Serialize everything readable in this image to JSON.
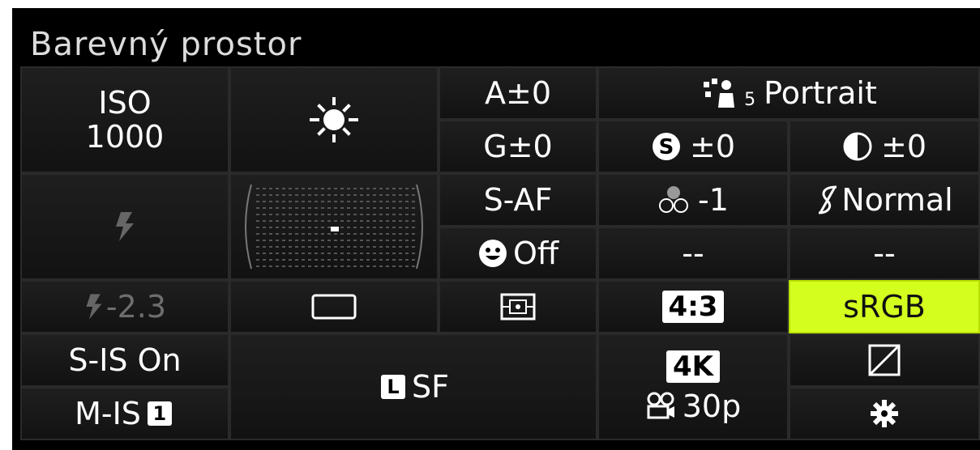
{
  "title": "Barevný prostor",
  "iso": {
    "label": "ISO",
    "value": "1000"
  },
  "white_balance": {
    "icon": "sun-icon"
  },
  "wb_adjust": {
    "a": "A±0",
    "g": "G±0"
  },
  "picture_mode": {
    "icon": "portrait-icon",
    "number": "5",
    "label": "Portrait"
  },
  "saturation": {
    "icon": "saturation-icon",
    "value": "±0"
  },
  "contrast": {
    "icon": "contrast-icon",
    "value": "±0"
  },
  "flash_mode": {
    "icon": "flash-icon"
  },
  "af_target": {
    "icon": "af-target-grid-icon"
  },
  "af_mode": {
    "label": "S-AF"
  },
  "sharpness": {
    "icon": "sharpness-icon",
    "value": "-1"
  },
  "gradation": {
    "icon": "gradation-icon",
    "value": "Normal"
  },
  "face_priority": {
    "icon": "face-icon",
    "value": "Off"
  },
  "blank1": {
    "value": "--"
  },
  "blank2": {
    "value": "--"
  },
  "flash_comp": {
    "icon": "flash-icon",
    "value": "-2.3"
  },
  "drive_mode": {
    "icon": "single-frame-icon"
  },
  "metering": {
    "icon": "metering-icon"
  },
  "aspect": {
    "value": "4:3"
  },
  "color_space": {
    "value": "sRGB",
    "highlight": "#d4ff1e"
  },
  "stabilizer": {
    "still": "S-IS On",
    "movie": "M-IS",
    "movie_level": "1"
  },
  "image_quality": {
    "size": "L",
    "quality": "SF"
  },
  "movie_quality": {
    "resolution": "4K",
    "fps": "30p",
    "icon": "movie-camera-icon"
  },
  "picture_profile": {
    "icon": "tone-curve-icon"
  },
  "settings": {
    "icon": "gear-icon"
  }
}
